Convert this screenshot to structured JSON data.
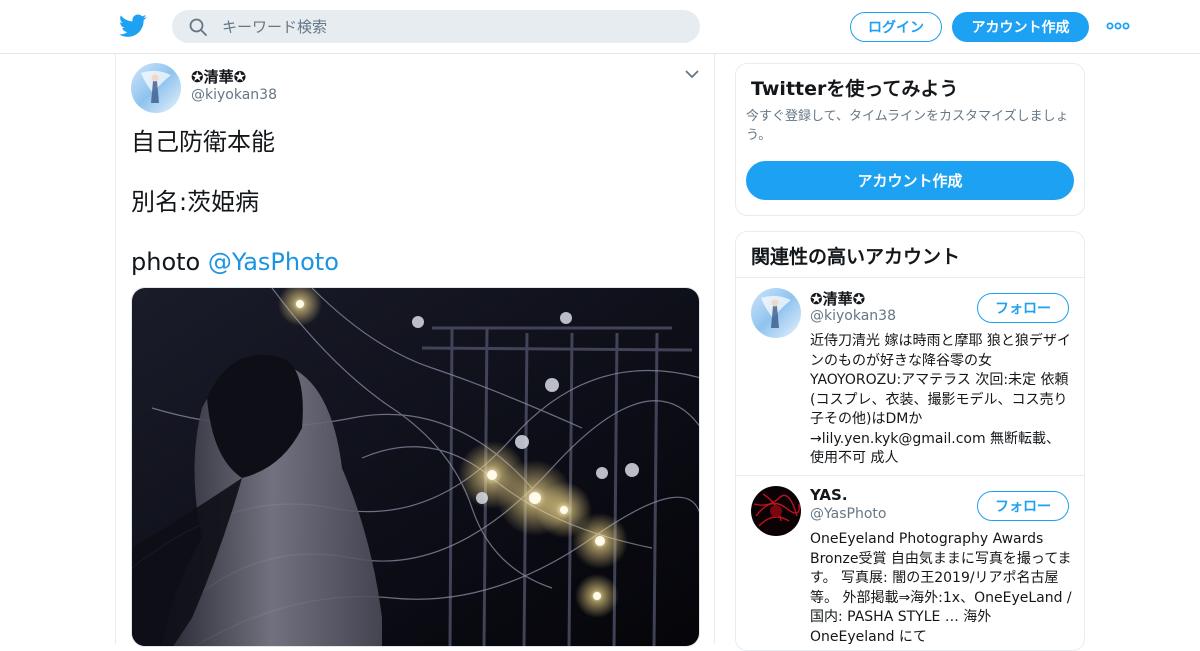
{
  "header": {
    "logo_icon": "twitter-bird-icon",
    "search_placeholder": "キーワード検索",
    "login_label": "ログイン",
    "signup_label": "アカウント作成",
    "more_icon": "more-dots-icon",
    "accent_color": "#1da1f2"
  },
  "tweet": {
    "author_name": "✪清華✪",
    "author_handle": "@kiyokan38",
    "line1": "自己防衛本能",
    "line2": "別名:茨姫病",
    "line3_text": "photo ",
    "line3_mention": "@YasPhoto"
  },
  "signup_card": {
    "title": "Twitterを使ってみよう",
    "subtitle": "今すぐ登録して、タイムラインをカスタマイズしましょう。",
    "button_label": "アカウント作成"
  },
  "related": {
    "title": "関連性の高いアカウント",
    "accounts": [
      {
        "name": "✪清華✪",
        "handle": "@kiyokan38",
        "follow_label": "フォロー",
        "bio": "近侍刀清光 嫁は時雨と摩耶 狼と狼デザインのものが好きな降谷零の女 YAOYOROZU:アマテラス 次回:未定 依頼(コスプレ、衣装、撮影モデル、コス売り子その他)はDMか→lily.yen.kyk@gmail.com 無断転載、使用不可 成人"
      },
      {
        "name": "YAS.",
        "handle": "@YasPhoto",
        "follow_label": "フォロー",
        "bio": "OneEyeland Photography Awards Bronze受賞 自由気ままに写真を撮ってます。 写真展: 闇の王2019/リアポ名古屋等。 外部掲載⇒海外:1x、OneEyeLand / 国内: PASHA STYLE … 海外OneEyeland にて"
      }
    ]
  }
}
